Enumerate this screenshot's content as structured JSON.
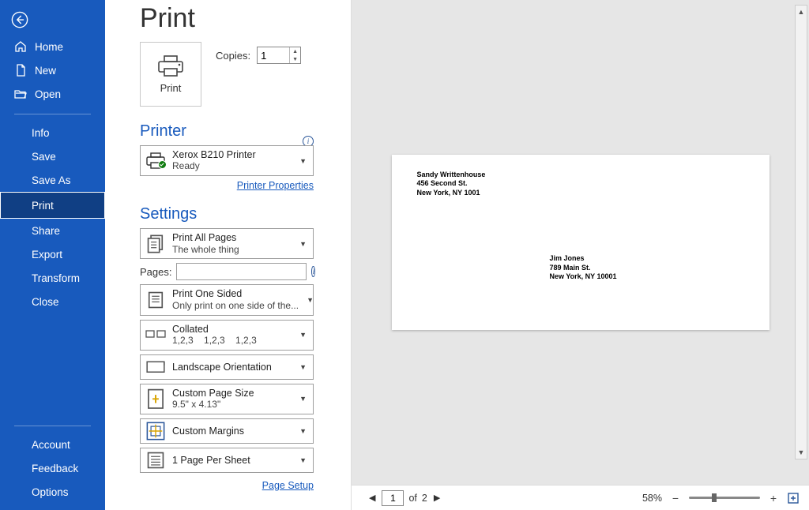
{
  "page_title": "Print",
  "sidebar": {
    "back": "Back",
    "top": [
      {
        "label": "Home"
      },
      {
        "label": "New"
      },
      {
        "label": "Open"
      }
    ],
    "file": [
      {
        "label": "Info"
      },
      {
        "label": "Save"
      },
      {
        "label": "Save As"
      },
      {
        "label": "Print"
      },
      {
        "label": "Share"
      },
      {
        "label": "Export"
      },
      {
        "label": "Transform"
      },
      {
        "label": "Close"
      }
    ],
    "bottom": [
      {
        "label": "Account"
      },
      {
        "label": "Feedback"
      },
      {
        "label": "Options"
      }
    ]
  },
  "print_panel": {
    "print_button": "Print",
    "copies_label": "Copies:",
    "copies_value": "1",
    "printer_heading": "Printer",
    "printer": {
      "name": "Xerox B210 Printer",
      "status": "Ready"
    },
    "printer_properties_link": "Printer Properties",
    "settings_heading": "Settings",
    "pages_label": "Pages:",
    "pages_value": "",
    "settings": {
      "what": {
        "line1": "Print All Pages",
        "line2": "The whole thing"
      },
      "sides": {
        "line1": "Print One Sided",
        "line2": "Only print on one side of the..."
      },
      "collate": {
        "line1": "Collated",
        "line2": "1,2,3    1,2,3    1,2,3"
      },
      "orient": {
        "line1": "Landscape Orientation"
      },
      "size": {
        "line1": "Custom Page Size",
        "line2": "9.5\" x 4.13\""
      },
      "margins": {
        "line1": "Custom Margins"
      },
      "sheet": {
        "line1": "1 Page Per Sheet"
      }
    },
    "page_setup_link": "Page Setup"
  },
  "preview": {
    "sender": {
      "name": "Sandy Writtenhouse",
      "street": "456 Second St.",
      "city": "New York, NY 1001"
    },
    "recipient": {
      "name": "Jim Jones",
      "street": "789 Main St.",
      "city": "New York, NY 10001"
    },
    "page_current": "1",
    "page_of_label": "of",
    "page_total": "2",
    "zoom_label": "58%"
  },
  "colors": {
    "accent": "#185ABD"
  }
}
